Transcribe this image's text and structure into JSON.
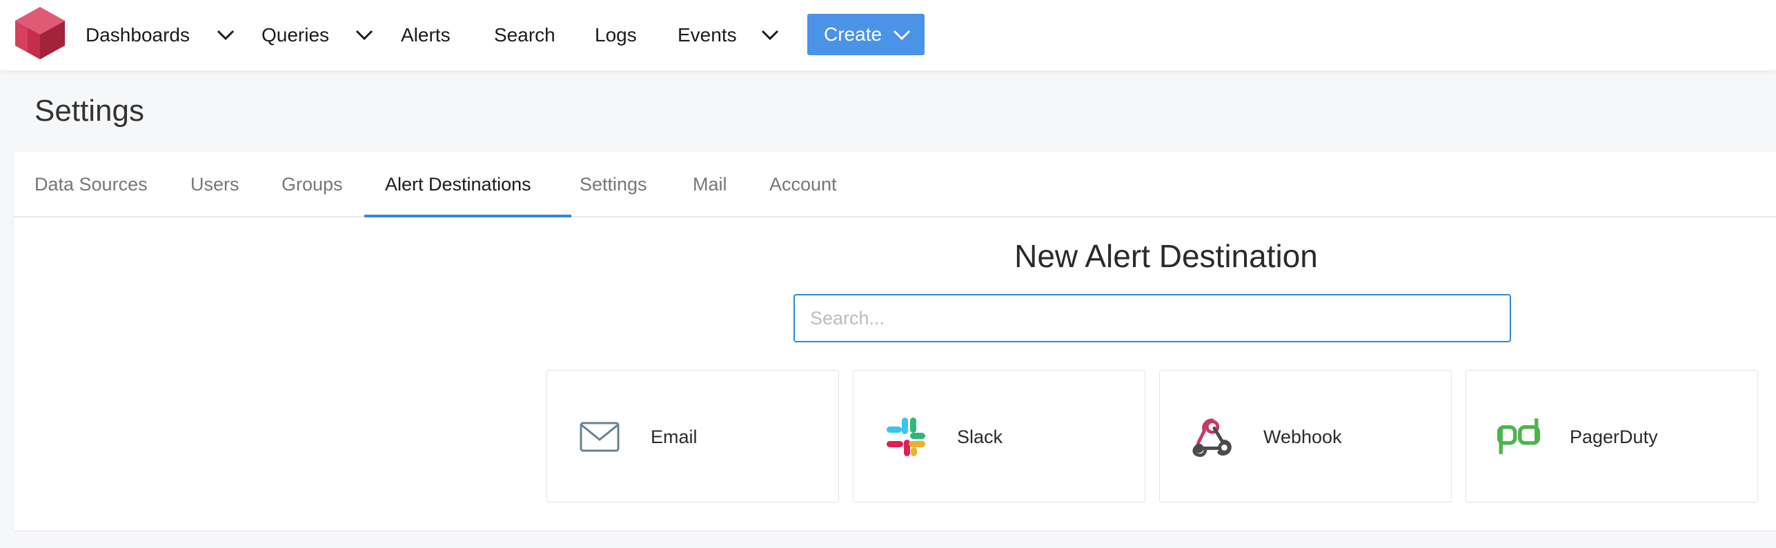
{
  "nav": {
    "items": [
      {
        "label": "Dashboards",
        "has_menu": true
      },
      {
        "label": "Queries",
        "has_menu": true
      },
      {
        "label": "Alerts",
        "has_menu": false
      },
      {
        "label": "Search",
        "has_menu": false
      },
      {
        "label": "Logs",
        "has_menu": false
      },
      {
        "label": "Events",
        "has_menu": true
      }
    ],
    "create_label": "Create",
    "accent_color": "#4a93e6"
  },
  "page": {
    "title": "Settings"
  },
  "tabs": [
    {
      "label": "Data Sources",
      "active": false
    },
    {
      "label": "Users",
      "active": false
    },
    {
      "label": "Groups",
      "active": false
    },
    {
      "label": "Alert Destinations",
      "active": true
    },
    {
      "label": "Settings",
      "active": false
    },
    {
      "label": "Mail",
      "active": false
    },
    {
      "label": "Account",
      "active": false
    }
  ],
  "new_destination": {
    "title": "New Alert Destination",
    "search_placeholder": "Search...",
    "search_value": "",
    "options": [
      {
        "label": "Email",
        "icon": "envelope-icon"
      },
      {
        "label": "Slack",
        "icon": "slack-icon"
      },
      {
        "label": "Webhook",
        "icon": "webhook-icon"
      },
      {
        "label": "PagerDuty",
        "icon": "pagerduty-icon"
      }
    ]
  }
}
